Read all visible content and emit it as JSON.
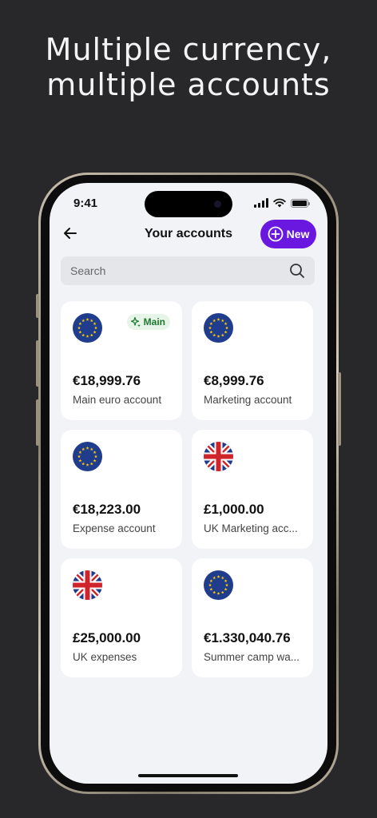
{
  "headline": {
    "line1": "Multiple currency,",
    "line2": "multiple accounts"
  },
  "status_bar": {
    "time": "9:41"
  },
  "nav": {
    "title": "Your accounts",
    "new_label": "New"
  },
  "search": {
    "placeholder": "Search"
  },
  "badge": {
    "label": "Main"
  },
  "accounts": [
    {
      "amount": "€18,999.76",
      "name": "Main euro account",
      "currency": "EUR",
      "main": true
    },
    {
      "amount": "€8,999.76",
      "name": "Marketing account",
      "currency": "EUR"
    },
    {
      "amount": "€18,223.00",
      "name": "Expense account",
      "currency": "EUR"
    },
    {
      "amount": "£1,000.00",
      "name": "UK Marketing acc...",
      "currency": "GBP"
    },
    {
      "amount": "£25,000.00",
      "name": "UK expenses",
      "currency": "GBP"
    },
    {
      "amount": "€1.330,040.76",
      "name": "Summer camp wa...",
      "currency": "EUR"
    }
  ],
  "colors": {
    "accent": "#6a18e0",
    "background": "#28282b",
    "screen": "#f2f3f6",
    "badge_bg": "#e6f5e8",
    "badge_text": "#1d7a2e"
  },
  "icons": {
    "back": "arrow-left-icon",
    "new": "plus-circle-icon",
    "search": "search-icon",
    "eu_flag": "eu-flag-icon",
    "uk_flag": "uk-flag-icon",
    "main_badge": "sparkle-icon"
  }
}
